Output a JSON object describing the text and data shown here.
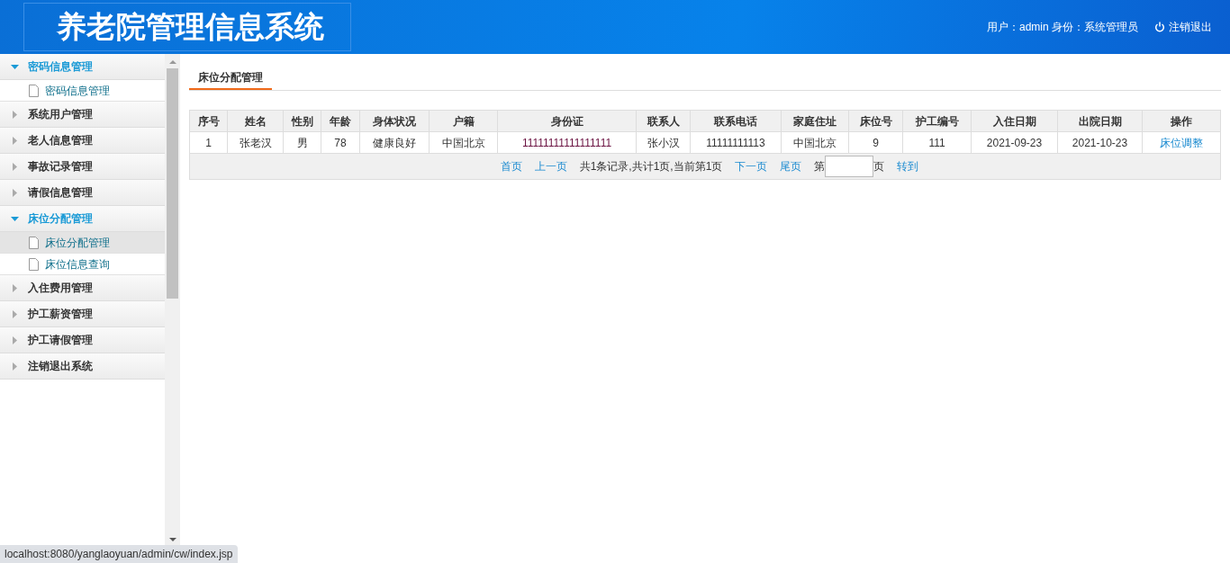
{
  "header": {
    "title": "养老院管理信息系统",
    "user_info": "用户：admin 身份：系统管理员",
    "logout": "注销退出"
  },
  "sidebar": {
    "groups": [
      {
        "label": "密码信息管理",
        "expanded": true,
        "children": [
          {
            "label": "密码信息管理",
            "selected": false
          }
        ]
      },
      {
        "label": "系统用户管理",
        "expanded": false
      },
      {
        "label": "老人信息管理",
        "expanded": false
      },
      {
        "label": "事故记录管理",
        "expanded": false
      },
      {
        "label": "请假信息管理",
        "expanded": false
      },
      {
        "label": "床位分配管理",
        "expanded": true,
        "children": [
          {
            "label": "床位分配管理",
            "selected": true
          },
          {
            "label": "床位信息查询",
            "selected": false
          }
        ]
      },
      {
        "label": "入住费用管理",
        "expanded": false
      },
      {
        "label": "护工薪资管理",
        "expanded": false
      },
      {
        "label": "护工请假管理",
        "expanded": false
      },
      {
        "label": "注销退出系统",
        "expanded": false
      }
    ]
  },
  "tab": {
    "label": "床位分配管理",
    "selected": true
  },
  "table": {
    "columns": [
      "序号",
      "姓名",
      "性别",
      "年龄",
      "身体状况",
      "户籍",
      "身份证",
      "联系人",
      "联系电话",
      "家庭住址",
      "床位号",
      "护工编号",
      "入住日期",
      "出院日期",
      "操作"
    ],
    "rows": [
      {
        "cells": [
          "1",
          "张老汉",
          "男",
          "78",
          "健康良好",
          "中国北京",
          "11111111111111111",
          "张小汉",
          "11111111113",
          "中国北京",
          "9",
          "111",
          "2021-09-23",
          "2021-10-23"
        ],
        "action": "床位调整"
      }
    ]
  },
  "pagination": [
    {
      "kind": "link",
      "text": "首页"
    },
    {
      "kind": "link",
      "text": "上一页"
    },
    {
      "kind": "text",
      "text": "共1条记录,共计1页,当前第1页"
    },
    {
      "kind": "link",
      "text": "下一页"
    },
    {
      "kind": "link",
      "text": "尾页"
    },
    {
      "kind": "text",
      "text": "第"
    },
    {
      "kind": "input"
    },
    {
      "kind": "text",
      "text": "页"
    },
    {
      "kind": "link",
      "text": "转到"
    }
  ],
  "status_bar": {
    "url": "localhost:8080/yanglaoyuan/admin/cw/index.jsp"
  }
}
